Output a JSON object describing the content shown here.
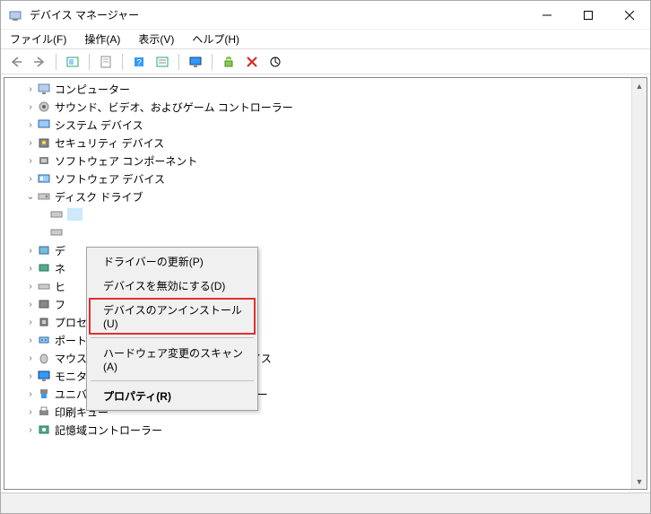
{
  "window": {
    "title": "デバイス マネージャー"
  },
  "menu": {
    "file": "ファイル(F)",
    "action": "操作(A)",
    "view": "表示(V)",
    "help": "ヘルプ(H)"
  },
  "tree": {
    "computer": "コンピューター",
    "sound": "サウンド、ビデオ、およびゲーム コントローラー",
    "system": "システム デバイス",
    "security": "セキュリティ デバイス",
    "softcomp": "ソフトウェア コンポーネント",
    "softdev": "ソフトウェア デバイス",
    "disk": "ディスク ドライブ",
    "dei": "デ",
    "net": "ネ",
    "hi": "ヒ",
    "fa": "フ",
    "processor": "プロセッサ",
    "ports": "ポート (COM と LPT)",
    "mouse": "マウスとそのほかのポインティング デバイス",
    "monitor": "モニター",
    "usb": "ユニバーサル シリアル バス コントローラー",
    "printq": "印刷キュー",
    "storage": "記憶域コントローラー"
  },
  "context": {
    "update": "ドライバーの更新(P)",
    "disable": "デバイスを無効にする(D)",
    "uninstall": "デバイスのアンインストール(U)",
    "scan": "ハードウェア変更のスキャン(A)",
    "properties": "プロパティ(R)"
  }
}
